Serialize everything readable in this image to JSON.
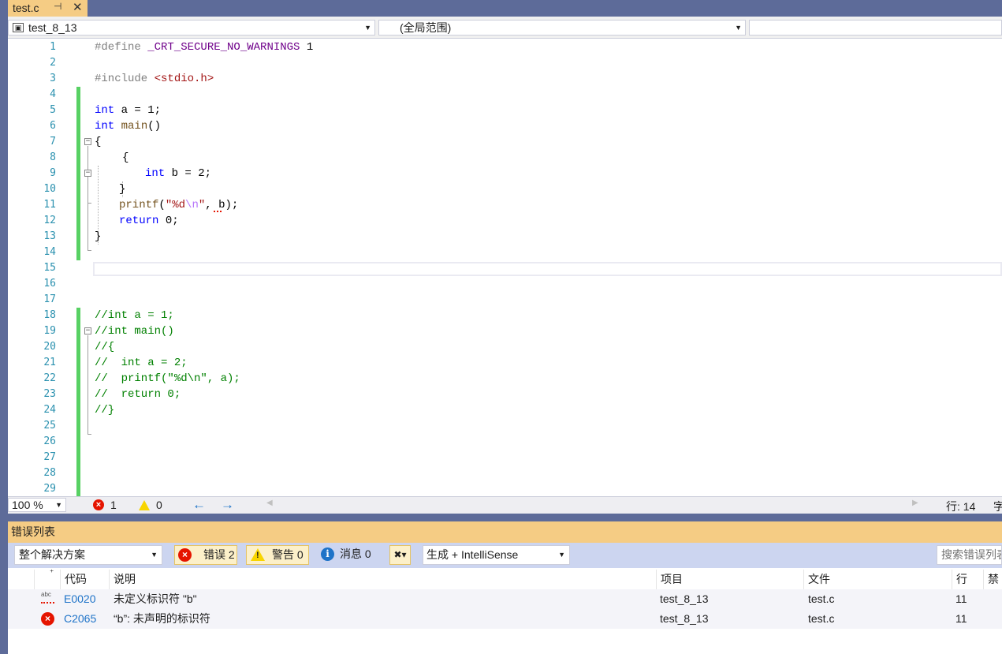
{
  "tab": {
    "filename": "test.c",
    "pin_glyph": "⊣",
    "close_glyph": "✕"
  },
  "navbar": {
    "project": "test_8_13",
    "scope": "(全局范围)",
    "member": ""
  },
  "code": {
    "line_numbers": [
      "1",
      "2",
      "3",
      "4",
      "5",
      "6",
      "7",
      "8",
      "9",
      "10",
      "11",
      "12",
      "13",
      "14",
      "15",
      "16",
      "17",
      "18",
      "19",
      "20",
      "21",
      "22",
      "23",
      "24",
      "25",
      "26",
      "27",
      "28",
      "29"
    ],
    "l1_define": "#define",
    "l1_macro": "_CRT_SECURE_NO_WARNINGS",
    "l1_value": " 1",
    "l3_include": "#include",
    "l3_header": "<stdio.h>",
    "l5_kw": "int",
    "l5_rest": " a = 1;",
    "l6_kw": "int",
    "l6_fn": " main",
    "l6_rest": "()",
    "l7": "{",
    "l8": "{",
    "l9_kw": "int",
    "l9_rest": " b = 2;",
    "l10": "}",
    "l11_fn": "printf",
    "l11_p1": "(",
    "l11_s1": "\"%d",
    "l11_esc": "\\n",
    "l11_s2": "\"",
    "l11_p2": ", ",
    "l11_var": "b",
    "l11_p3": ");",
    "l12_kw": "return",
    "l12_rest": " 0;",
    "l13": "}",
    "l18": "//int a = 1;",
    "l19": "//int main()",
    "l20": "//{",
    "l21": "//  int a = 2;",
    "l22": "//  printf(\"%d\\n\", a);",
    "l23": "//  return 0;",
    "l24": "//}"
  },
  "editor_status": {
    "zoom": "100 %",
    "error_count": "1",
    "warning_count": "0",
    "back_glyph": "←",
    "forward_glyph": "→",
    "row_label": "行: 14",
    "char_label": "字"
  },
  "error_list": {
    "title": "错误列表",
    "scope": "整个解决方案",
    "errors_button": "错误 2",
    "warnings_button": "警告 0",
    "messages_button": "消息 0",
    "build_filter": "生成 + IntelliSense",
    "search_placeholder": "搜索错误列表",
    "columns": {
      "code": "代码",
      "description": "说明",
      "project": "项目",
      "file": "文件",
      "line": "行",
      "suppress": "禁"
    },
    "rows": [
      {
        "icon": "spelling-error-icon",
        "code": "E0020",
        "description": "未定义标识符 \"b\"",
        "project": "test_8_13",
        "file": "test.c",
        "line": "11"
      },
      {
        "icon": "error-icon",
        "code": "C2065",
        "description": "“b”: 未声明的标识符",
        "project": "test_8_13",
        "file": "test.c",
        "line": "11"
      }
    ]
  },
  "colors": {
    "tab_active": "#f5cc84",
    "chrome": "#5d6b99",
    "change_bar": "#57d163",
    "error": "#e51400",
    "keyword": "#0000ff",
    "comment": "#008000"
  }
}
